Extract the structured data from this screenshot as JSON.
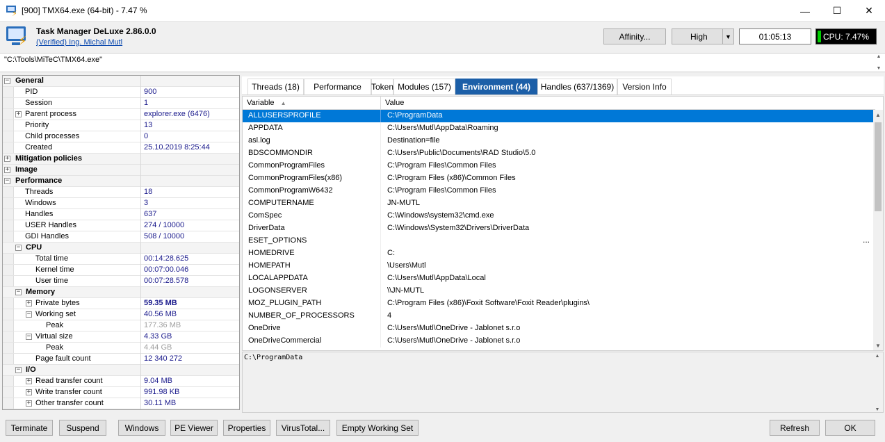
{
  "window": {
    "title": "[900] TMX64.exe (64-bit) - 7.47 %",
    "minimize": "—",
    "maximize": "☐",
    "close": "✕"
  },
  "header": {
    "app_name": "Task Manager DeLuxe 2.86.0.0",
    "verified": "(Verified) Ing. Michal Mutl",
    "affinity_label": "Affinity...",
    "priority_value": "High",
    "elapsed_time": "01:05:13",
    "cpu_label": "CPU: 7.47%"
  },
  "path": "\"C:\\Tools\\MiTeC\\TMX64.exe\"",
  "tree": [
    {
      "kind": "group",
      "pm": "−",
      "name": "General"
    },
    {
      "kind": "item",
      "name": "PID",
      "value": "900"
    },
    {
      "kind": "item",
      "name": "Session",
      "value": "1"
    },
    {
      "kind": "item",
      "pm": "+",
      "name": "Parent process",
      "value": "explorer.exe (6476)"
    },
    {
      "kind": "item",
      "name": "Priority",
      "value": "13"
    },
    {
      "kind": "item",
      "name": "Child processes",
      "value": "0"
    },
    {
      "kind": "item",
      "name": "Created",
      "value": "25.10.2019 8:25:44"
    },
    {
      "kind": "group",
      "pm": "+",
      "name": "Mitigation policies"
    },
    {
      "kind": "group",
      "pm": "+",
      "name": "Image"
    },
    {
      "kind": "group",
      "pm": "−",
      "name": "Performance"
    },
    {
      "kind": "item",
      "name": "Threads",
      "value": "18"
    },
    {
      "kind": "item",
      "name": "Windows",
      "value": "3"
    },
    {
      "kind": "item",
      "name": "Handles",
      "value": "637"
    },
    {
      "kind": "item",
      "name": "USER Handles",
      "value": "274 / 10000"
    },
    {
      "kind": "item",
      "name": "GDI Handles",
      "value": "508 / 10000"
    },
    {
      "kind": "subgroup",
      "pm": "−",
      "name": "CPU"
    },
    {
      "kind": "sub",
      "name": "Total time",
      "value": "00:14:28.625"
    },
    {
      "kind": "sub",
      "name": "Kernel time",
      "value": "00:07:00.046"
    },
    {
      "kind": "sub",
      "name": "User time",
      "value": "00:07:28.578"
    },
    {
      "kind": "subgroup",
      "pm": "−",
      "name": "Memory"
    },
    {
      "kind": "sub",
      "pm": "+",
      "name": "Private bytes",
      "value": "59.35 MB",
      "style": "bold"
    },
    {
      "kind": "sub",
      "pm": "−",
      "name": "Working set",
      "value": "40.56 MB"
    },
    {
      "kind": "subsub",
      "name": "Peak",
      "value": "177.36 MB",
      "style": "gray"
    },
    {
      "kind": "sub",
      "pm": "−",
      "name": "Virtual size",
      "value": "4.33 GB"
    },
    {
      "kind": "subsub",
      "name": "Peak",
      "value": "4.44 GB",
      "style": "gray"
    },
    {
      "kind": "sub",
      "name": "Page fault count",
      "value": "12 340 272"
    },
    {
      "kind": "subgroup",
      "pm": "−",
      "name": "I/O"
    },
    {
      "kind": "sub",
      "pm": "+",
      "name": "Read transfer count",
      "value": "9.04 MB"
    },
    {
      "kind": "sub",
      "pm": "+",
      "name": "Write transfer count",
      "value": "991.98 KB"
    },
    {
      "kind": "sub",
      "pm": "+",
      "name": "Other transfer count",
      "value": "30.11 MB"
    }
  ],
  "tabs": [
    {
      "label": "Threads (18)",
      "active": false
    },
    {
      "label": "Performance",
      "active": false
    },
    {
      "label": "Token",
      "active": false
    },
    {
      "label": "Modules (157)",
      "active": false
    },
    {
      "label": "Environment (44)",
      "active": true
    },
    {
      "label": "Handles (637/1369)",
      "active": false
    },
    {
      "label": "Version Info",
      "active": false
    }
  ],
  "grid": {
    "col_variable": "Variable",
    "sort_icon": "▲",
    "col_value": "Value",
    "rows": [
      {
        "variable": "ALLUSERSPROFILE",
        "value": "C:\\ProgramData"
      },
      {
        "variable": "APPDATA",
        "value": "C:\\Users\\Mutl\\AppData\\Roaming"
      },
      {
        "variable": "asl.log",
        "value": "Destination=file"
      },
      {
        "variable": "BDSCOMMONDIR",
        "value": "C:\\Users\\Public\\Documents\\RAD Studio\\5.0"
      },
      {
        "variable": "CommonProgramFiles",
        "value": "C:\\Program Files\\Common Files"
      },
      {
        "variable": "CommonProgramFiles(x86)",
        "value": "C:\\Program Files (x86)\\Common Files"
      },
      {
        "variable": "CommonProgramW6432",
        "value": "C:\\Program Files\\Common Files"
      },
      {
        "variable": "COMPUTERNAME",
        "value": "JN-MUTL"
      },
      {
        "variable": "ComSpec",
        "value": "C:\\Windows\\system32\\cmd.exe"
      },
      {
        "variable": "DriverData",
        "value": "C:\\Windows\\System32\\Drivers\\DriverData"
      },
      {
        "variable": "ESET_OPTIONS",
        "value": "",
        "ellipsis": "..."
      },
      {
        "variable": "HOMEDRIVE",
        "value": "C:"
      },
      {
        "variable": "HOMEPATH",
        "value": "\\Users\\Mutl"
      },
      {
        "variable": "LOCALAPPDATA",
        "value": "C:\\Users\\Mutl\\AppData\\Local"
      },
      {
        "variable": "LOGONSERVER",
        "value": "\\\\JN-MUTL"
      },
      {
        "variable": "MOZ_PLUGIN_PATH",
        "value": "C:\\Program Files (x86)\\Foxit Software\\Foxit Reader\\plugins\\"
      },
      {
        "variable": "NUMBER_OF_PROCESSORS",
        "value": "4"
      },
      {
        "variable": "OneDrive",
        "value": "C:\\Users\\Mutl\\OneDrive - Jablonet s.r.o"
      },
      {
        "variable": "OneDriveCommercial",
        "value": "C:\\Users\\Mutl\\OneDrive - Jablonet s.r.o"
      }
    ]
  },
  "detail_text": "C:\\ProgramData",
  "buttons": {
    "terminate": "Terminate",
    "suspend": "Suspend",
    "windows": "Windows",
    "pe_viewer": "PE Viewer",
    "properties": "Properties",
    "virustotal": "VirusTotal...",
    "empty_ws": "Empty Working Set",
    "refresh": "Refresh",
    "ok": "OK"
  },
  "colors": {
    "selection": "#0078d7",
    "active_tab": "#1c5fa8",
    "cpu_bar": "#00d000"
  }
}
